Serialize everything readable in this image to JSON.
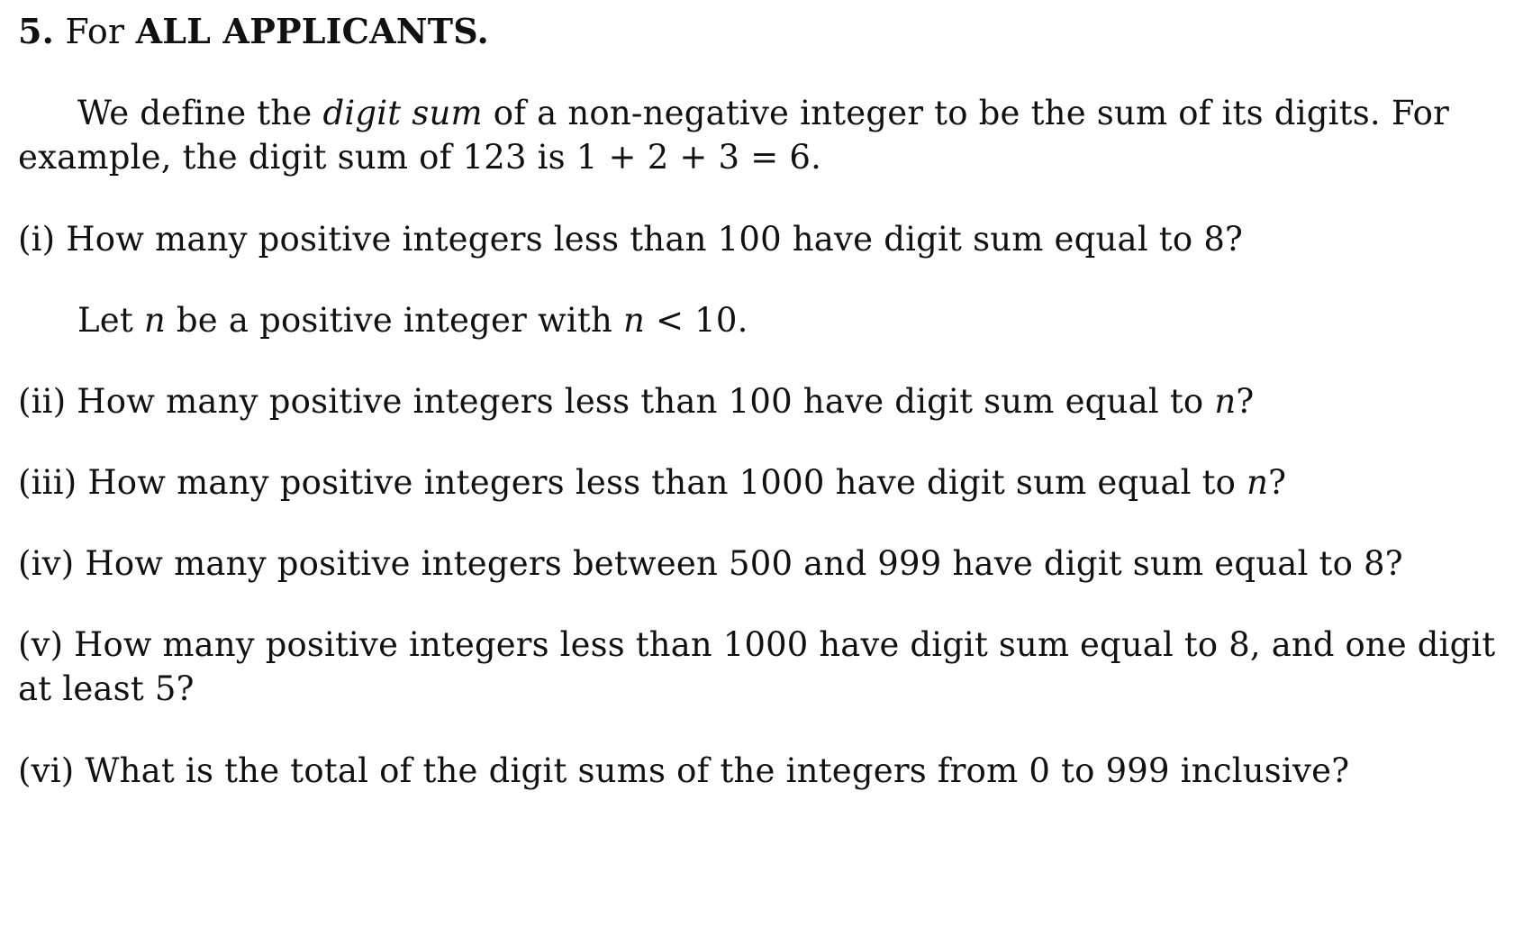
{
  "question": {
    "number": "5.",
    "for_label": "For",
    "audience": "ALL APPLICANTS."
  },
  "intro": {
    "line1_pre": "We define the",
    "term": "digit sum",
    "line1_post": "of a non-negative integer to be the sum of its digits.  For",
    "line2": "example, the digit sum of 123 is 1 + 2 + 3 = 6."
  },
  "parts": {
    "i": "(i) How many positive integers less than 100 have digit sum equal to 8?",
    "let": {
      "pre": "Let",
      "var1": "n",
      "mid": "be a positive integer with",
      "var2": "n",
      "post": "< 10."
    },
    "ii": {
      "text": "(ii) How many positive integers less than 100 have digit sum equal to",
      "var": "n",
      "end": "?"
    },
    "iii": {
      "text": "(iii) How many positive integers less than 1000 have digit sum equal to",
      "var": "n",
      "end": "?"
    },
    "iv": "(iv) How many positive integers between 500 and 999 have digit sum equal to 8?",
    "v_line1": "(v) How many positive integers less than 1000 have digit sum equal to 8, and one digit",
    "v_line2": "at least 5?",
    "vi": "(vi) What is the total of the digit sums of the integers from 0 to 999 inclusive?"
  }
}
